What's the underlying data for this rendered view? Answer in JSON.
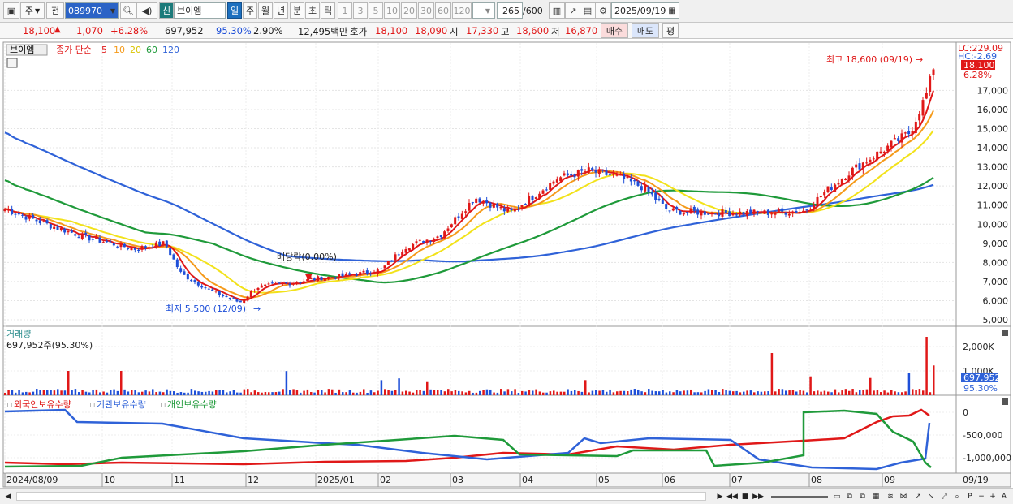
{
  "toolbar": {
    "period_sel": "주",
    "compare_label": "전",
    "code": "089970",
    "exchange": "신",
    "stock_name": "브이엠",
    "periods": [
      "일",
      "주",
      "월",
      "년",
      "분",
      "초",
      "틱"
    ],
    "intervals": [
      "1",
      "3",
      "5",
      "10",
      "20",
      "30",
      "60",
      "120"
    ],
    "count": "265",
    "count_max": "/600",
    "date": "2025/09/19"
  },
  "quote": {
    "price": "18,100",
    "change": "1,070",
    "change_pct": "+6.28%",
    "volume": "697,952",
    "vol_ratio": "95.30%",
    "turnover_rate": "2.90%",
    "amount": "12,495백만",
    "ask_label": "호가",
    "bid1": "18,100",
    "bid2": "18,090",
    "open_label": "시",
    "open": "17,330",
    "high_label": "고",
    "high": "18,600",
    "low_label": "저",
    "low": "16,870",
    "buy_label": "매수",
    "sell_label": "매도",
    "eval_label": "평"
  },
  "price_panel": {
    "stock_tag": "브이엠",
    "legend_prefix": "종가 단순",
    "ma_labels": [
      "5",
      "10",
      "20",
      "60",
      "120"
    ],
    "lc": "LC:229.09",
    "hc": "HC:-2.69",
    "price_tag": "18,100",
    "pct_tag": "6.28%",
    "yticks": [
      "17,000",
      "16,000",
      "15,000",
      "14,000",
      "13,000",
      "12,000",
      "11,000",
      "10,000",
      "9,000",
      "8,000",
      "7,000",
      "6,000",
      "5,000"
    ],
    "high_note": "최고 18,600 (09/19)",
    "low_note": "최저 5,500 (12/09)",
    "div_note": "배당락(0.00%)"
  },
  "volume_panel": {
    "title": "거래량",
    "desc": "697,952주(95.30%)",
    "yticks": [
      "2,000K",
      "1,000K"
    ],
    "vol_tag": "697,952",
    "pct_tag": "95.30%"
  },
  "holders_panel": {
    "legends": [
      "외국인보유수량",
      "기관보유수량",
      "개인보유수량"
    ],
    "yticks": [
      "0",
      "-500,000",
      "-1,000,000"
    ]
  },
  "xaxis": {
    "labels": [
      "2024/08/09",
      "10",
      "11",
      "12",
      "2025/01",
      "02",
      "03",
      "04",
      "05",
      "06",
      "07",
      "08",
      "09"
    ],
    "right_label": "09/19"
  },
  "colors": {
    "up": "#e01818",
    "down": "#1e4fd8",
    "ma5": "#e01818",
    "ma10": "#f59a1a",
    "ma20": "#f2e21a",
    "ma60": "#1f9a3a",
    "ma120": "#2f62d8"
  }
}
